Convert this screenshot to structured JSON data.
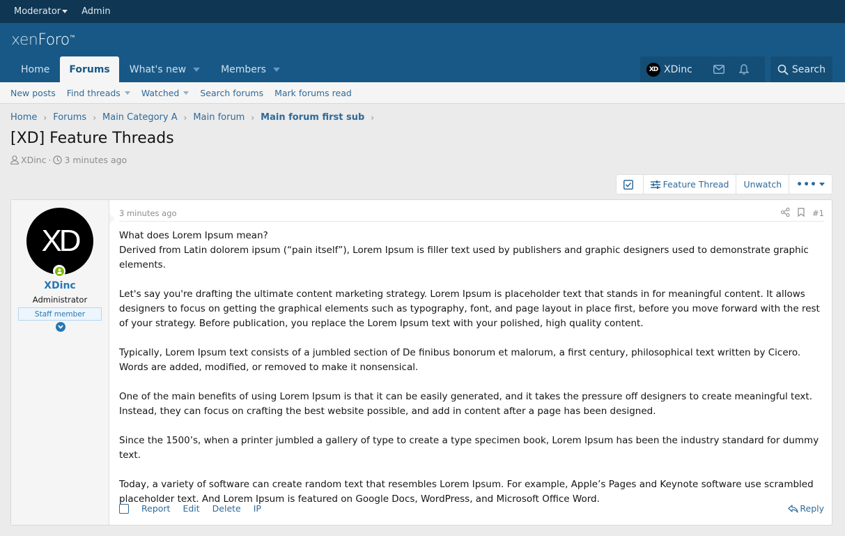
{
  "staff_bar": {
    "moderator": "Moderator",
    "admin": "Admin"
  },
  "header": {
    "logo_xen": "xen",
    "logo_foro": "Foro",
    "logo_tm": "™",
    "nav": [
      {
        "label": "Home",
        "active": false
      },
      {
        "label": "Forums",
        "active": true
      },
      {
        "label": "What's new",
        "active": false,
        "dropdown": true
      },
      {
        "label": "Members",
        "active": false,
        "dropdown": true
      }
    ],
    "user": {
      "avatar_initials": "XD",
      "name": "XDinc"
    },
    "search_label": "Search"
  },
  "subnav": [
    {
      "label": "New posts"
    },
    {
      "label": "Find threads",
      "dropdown": true
    },
    {
      "label": "Watched",
      "dropdown": true
    },
    {
      "label": "Search forums"
    },
    {
      "label": "Mark forums read"
    }
  ],
  "breadcrumb": [
    {
      "label": "Home"
    },
    {
      "label": "Forums"
    },
    {
      "label": "Main Category A"
    },
    {
      "label": "Main forum"
    },
    {
      "label": "Main forum first sub",
      "current": true
    }
  ],
  "thread": {
    "title": "[XD] Feature Threads",
    "author": "XDinc",
    "time": "3 minutes ago",
    "buttons": {
      "feature": "Feature Thread",
      "unwatch": "Unwatch",
      "more": "•••"
    }
  },
  "post": {
    "user": {
      "avatar_initials": "XD",
      "name": "XDinc",
      "title": "Administrator",
      "banner": "Staff member"
    },
    "time": "3 minutes ago",
    "number": "#1",
    "body": {
      "question": "What does Lorem Ipsum mean?",
      "paragraphs": [
        "Derived from Latin dolorem ipsum (“pain itself”), Lorem Ipsum is filler text used by publishers and graphic designers used to demonstrate graphic elements.",
        "Let's say you're drafting the ultimate content marketing strategy. Lorem Ipsum is placeholder text that stands in for meaningful content. It allows designers to focus on getting the graphical elements such as typography, font, and page layout in place first, before you move forward with the rest of your strategy. Before publication, you replace the Lorem Ipsum text with your polished, high quality content.",
        "Typically, Lorem Ipsum text consists of a jumbled section of De finibus bonorum et malorum, a first century, philosophical text written by Cicero. Words are added, modified, or removed to make it nonsensical.",
        "One of the main benefits of using Lorem Ipsum is that it can be easily generated, and it takes the pressure off designers to create meaningful text. Instead, they can focus on crafting the best website possible, and add in content after a page has been designed.",
        "Since the 1500’s, when a printer jumbled a gallery of type to create a type specimen book, Lorem Ipsum has been the industry standard for dummy text.",
        "Today, a variety of software can create random text that resembles Lorem Ipsum. For example, Apple’s Pages and Keynote software use scrambled placeholder text. And Lorem Ipsum is featured on Google Docs, WordPress, and Microsoft Office Word."
      ]
    },
    "actions": {
      "report": "Report",
      "edit": "Edit",
      "delete": "Delete",
      "ip": "IP",
      "reply": "Reply"
    }
  },
  "colors": {
    "staff_bar_bg": "#0f3652",
    "header_bg": "#185886",
    "link": "#2f6a99",
    "accent": "#2577b1",
    "online": "#7fb900"
  }
}
